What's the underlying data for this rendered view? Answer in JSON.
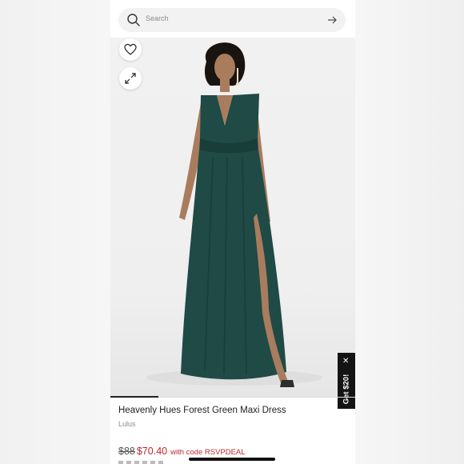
{
  "search": {
    "placeholder": "Search"
  },
  "product": {
    "title": "Heavenly Hues Forest Green Maxi Dress",
    "brand": "Lulus",
    "original_price": "$88",
    "sale_price": "$70.40",
    "promo_text": "with code RSVPDEAL"
  },
  "promo_tab": {
    "label": "Get $20!"
  },
  "icons": {
    "search": "search-icon",
    "submit": "arrow-right-icon",
    "favorite": "heart-icon",
    "expand": "expand-icon",
    "close": "close-icon"
  },
  "colors": {
    "dress": "#1f4a45",
    "sale_price": "#c0262d",
    "promo_tab": "#141414"
  }
}
